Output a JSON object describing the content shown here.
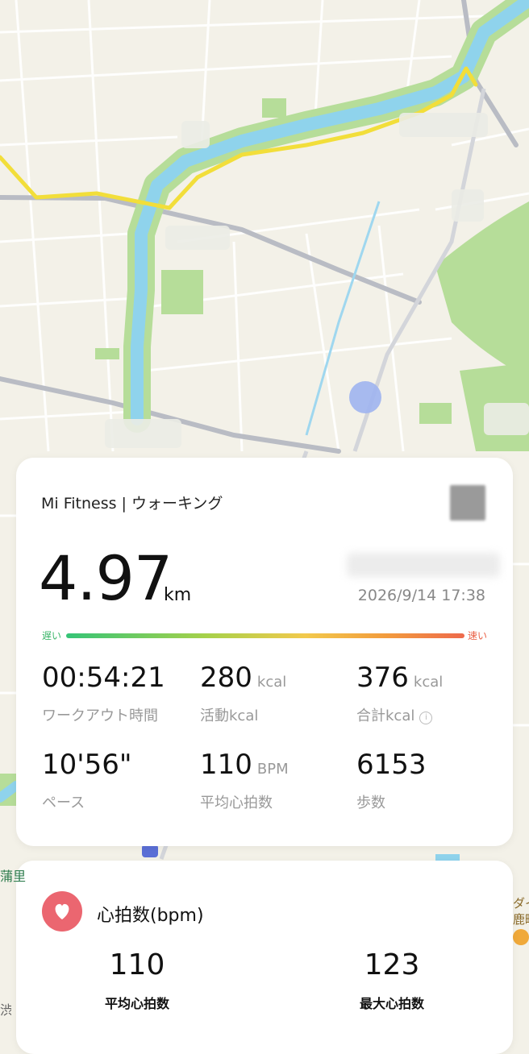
{
  "summary": {
    "app_title": "Mi Fitness | ウォーキング",
    "distance_value": "4.97",
    "distance_unit": "km",
    "datetime": "2026/9/14 17:38",
    "pace_scale": {
      "slow_label": "遅い",
      "fast_label": "速い"
    },
    "metrics": [
      {
        "value": "00:54:21",
        "unit": "",
        "label": "ワークアウト時間"
      },
      {
        "value": "280",
        "unit": "kcal",
        "label": "活動kcal"
      },
      {
        "value": "376",
        "unit": "kcal",
        "label": "合計kcal"
      },
      {
        "value": "10'56\"",
        "unit": "",
        "label": "ペース"
      },
      {
        "value": "110",
        "unit": "BPM",
        "label": "平均心拍数"
      },
      {
        "value": "6153",
        "unit": "",
        "label": "歩数"
      }
    ],
    "info_icon": "i"
  },
  "heart_rate": {
    "title": "心拍数(bpm)",
    "avg_value": "110",
    "avg_label": "平均心拍数",
    "max_value": "123",
    "max_label": "最大心拍数"
  },
  "map": {
    "partial_labels": [
      "蒲里",
      "ダイ",
      "鹿町",
      "渋"
    ]
  },
  "colors": {
    "accent_heart": "#eb6670",
    "route": "#f2de3a",
    "river": "#8fd3ec",
    "park": "#b6dd99",
    "location_dot": "#9fb4ef"
  }
}
